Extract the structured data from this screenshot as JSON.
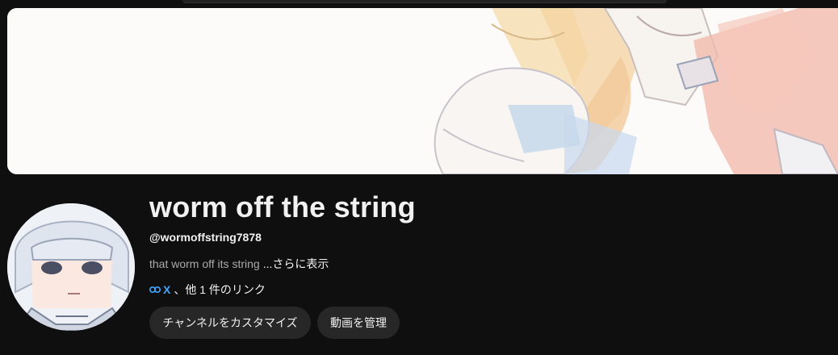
{
  "channel": {
    "name": "worm off the string",
    "handle": "@wormoffstring7878",
    "description": "that worm off its string",
    "more_label": "...さらに表示"
  },
  "links": {
    "icon": "link-icon",
    "first": "X",
    "more": "、他 1 件のリンク"
  },
  "buttons": {
    "customize": "チャンネルをカスタマイズ",
    "manage": "動画を管理"
  },
  "colors": {
    "background": "#0f0f0f",
    "text": "#f1f1f1",
    "muted": "#aaaaaa",
    "link": "#3ea6ff",
    "button": "#272727"
  }
}
